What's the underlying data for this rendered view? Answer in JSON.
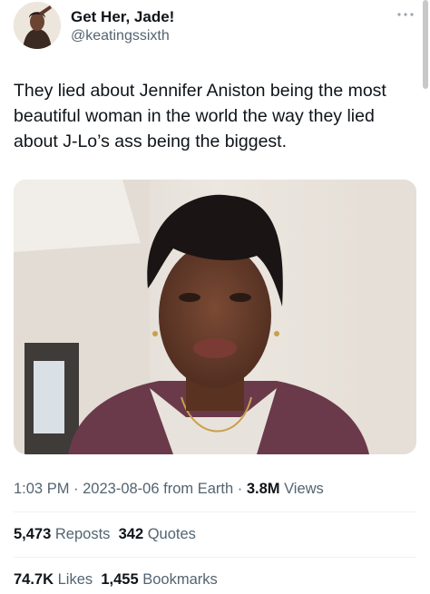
{
  "author": {
    "display_name": "Get Her, Jade!",
    "handle": "@keatingssixth",
    "avatar_icon": "profile-photo"
  },
  "more_icon": "more-dots-icon",
  "tweet": {
    "text": "They lied about Jennifer Aniston being the most beautiful woman in the world the way they lied about J-Lo’s ass being the biggest."
  },
  "media": {
    "description_icon": "photo-woman-short-hair",
    "colors": {
      "wall": "#e8e3dc",
      "cardigan": "#6a3a4a",
      "skin": "#6b3f2c",
      "hair": "#1a1414"
    }
  },
  "meta": {
    "time": "1:03 PM",
    "sep1": " · ",
    "date": "2023-08-06",
    "source": " from Earth",
    "sep2": " · ",
    "views_count": "3.8M",
    "views_label": " Views"
  },
  "stats": {
    "reposts_count": "5,473",
    "reposts_label": "Reposts",
    "quotes_count": "342",
    "quotes_label": "Quotes",
    "likes_count": "74.7K",
    "likes_label": "Likes",
    "bookmarks_count": "1,455",
    "bookmarks_label": "Bookmarks"
  }
}
